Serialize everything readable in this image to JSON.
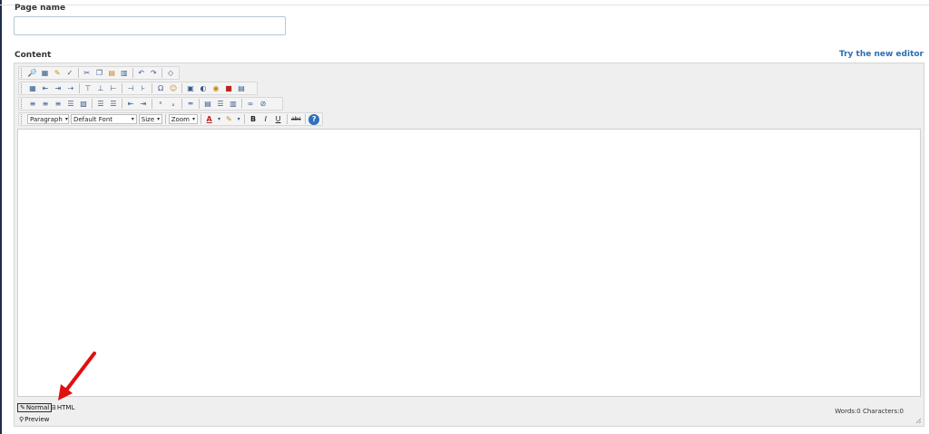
{
  "page_name": {
    "label": "Page name",
    "value": "",
    "placeholder": ""
  },
  "content": {
    "label": "Content",
    "try_link": "Try the new editor"
  },
  "toolbar": {
    "row4": {
      "paragraph": "Paragraph",
      "font": "Default Font",
      "size": "Size",
      "zoom": "Zoom",
      "bold": "B",
      "italic": "I",
      "underline": "U",
      "strike": "abc"
    }
  },
  "footer": {
    "normal": "Normal",
    "html": "HTML",
    "preview": "Preview",
    "counts": "Words:0 Characters:0"
  },
  "colors": {
    "accent_link": "#2a6fb0",
    "annotation_arrow": "#e01010"
  }
}
